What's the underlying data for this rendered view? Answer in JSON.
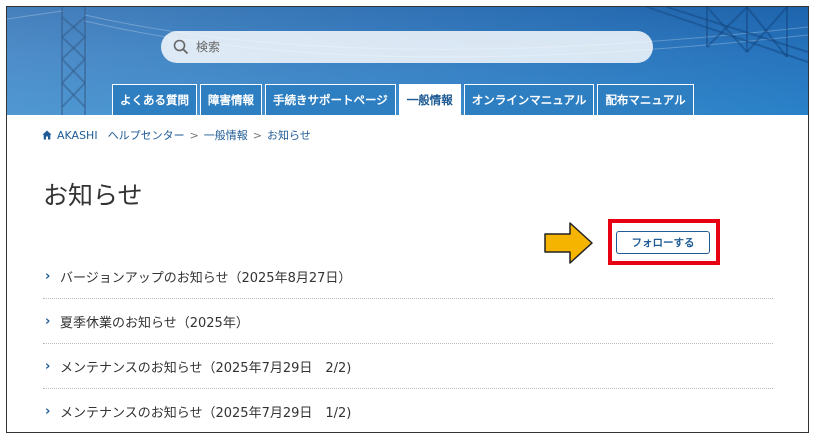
{
  "search": {
    "placeholder": "検索"
  },
  "tabs": [
    {
      "label": "よくある質問",
      "active": false
    },
    {
      "label": "障害情報",
      "active": false
    },
    {
      "label": "手続きサポートページ",
      "active": false
    },
    {
      "label": "一般情報",
      "active": true
    },
    {
      "label": "オンラインマニュアル",
      "active": false
    },
    {
      "label": "配布マニュアル",
      "active": false
    }
  ],
  "breadcrumb": {
    "home": "AKASHI",
    "items": [
      "ヘルプセンター",
      "一般情報",
      "お知らせ"
    ],
    "separator": ">"
  },
  "page": {
    "title": "お知らせ",
    "follow_label": "フォローする"
  },
  "articles": [
    "バージョンアップのお知らせ（2025年8月27日）",
    "夏季休業のお知らせ（2025年）",
    "メンテナンスのお知らせ（2025年7月29日　2/2)",
    "メンテナンスのお知らせ（2025年7月29日　1/2)"
  ],
  "colors": {
    "header_blue": "#2774bd",
    "link_blue": "#1f5b95",
    "highlight_red": "#e60012",
    "arrow_yellow": "#f5b400"
  },
  "icons": {
    "search": "search-icon",
    "home": "home-icon",
    "chevron": "chevron-right-icon",
    "callout": "arrow-right-icon"
  }
}
